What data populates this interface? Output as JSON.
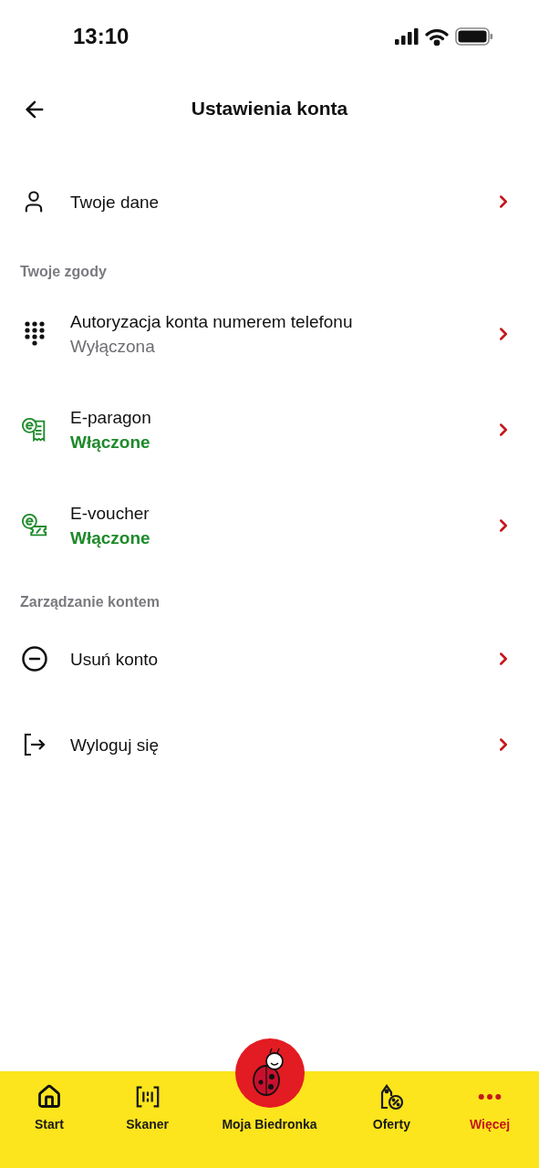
{
  "status_bar": {
    "time": "13:10"
  },
  "header": {
    "title": "Ustawienia konta"
  },
  "sections": [
    {
      "items": [
        {
          "kind": "person",
          "label": "Twoje dane"
        }
      ]
    },
    {
      "heading": "Twoje zgody",
      "items": [
        {
          "kind": "keypad",
          "label": "Autoryzacja konta numerem telefonu",
          "status": "Wyłączona",
          "enabled": false
        },
        {
          "kind": "ereceipt",
          "label": "E-paragon",
          "status": "Włączone",
          "enabled": true
        },
        {
          "kind": "evoucher",
          "label": "E-voucher",
          "status": "Włączone",
          "enabled": true
        }
      ]
    },
    {
      "heading": "Zarządzanie kontem",
      "items": [
        {
          "kind": "minus-circle",
          "label": "Usuń konto"
        },
        {
          "kind": "logout",
          "label": "Wyloguj się"
        }
      ]
    }
  ],
  "bottom_nav": [
    {
      "kind": "home",
      "label": "Start",
      "selected": false
    },
    {
      "kind": "scanner",
      "label": "Skaner",
      "selected": false
    },
    {
      "kind": "ladybug",
      "label": "Moja Biedronka",
      "selected": false
    },
    {
      "kind": "tag",
      "label": "Oferty",
      "selected": false
    },
    {
      "kind": "more",
      "label": "Więcej",
      "selected": true
    }
  ]
}
